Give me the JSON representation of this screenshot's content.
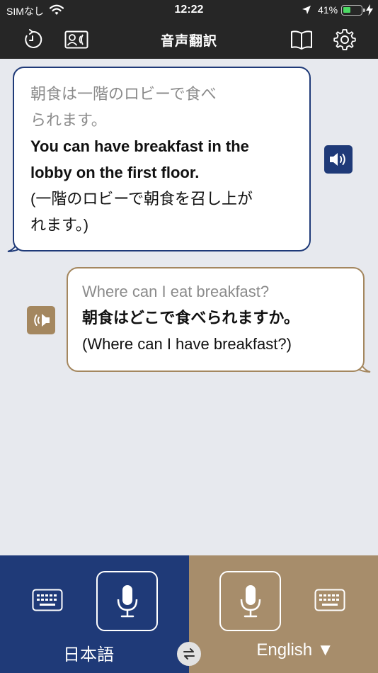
{
  "status_bar": {
    "carrier": "SIMなし",
    "time": "12:22",
    "battery_percent": "41%",
    "battery_level": 0.41,
    "icons": [
      "wifi-icon",
      "location-arrow-icon",
      "battery-icon",
      "charging-bolt-icon"
    ]
  },
  "nav": {
    "title": "音声翻訳",
    "left_icons": [
      "history-icon",
      "contact-card-icon"
    ],
    "right_icons": [
      "book-icon",
      "gear-icon"
    ]
  },
  "conversation": [
    {
      "speaker": "english-side",
      "source_lines": [
        "朝食は一階のロビーで食べ",
        "られます。"
      ],
      "translation_lines": [
        "You can have breakfast in the",
        "lobby on the first floor."
      ],
      "back_translation_lines": [
        "(一階のロビーで朝食を召し上が",
        "れます。)"
      ],
      "action_icon": "speaker-icon"
    },
    {
      "speaker": "japanese-side",
      "source_lines": [
        "Where can I eat breakfast?"
      ],
      "translation_lines": [
        "朝食はどこで食べられますか。"
      ],
      "back_translation_lines": [
        "(Where can I have breakfast?)"
      ],
      "action_icon": "speaker-icon"
    }
  ],
  "bottom": {
    "left_language": "日本語",
    "right_language": "English ▼",
    "mic_icon": "microphone-icon",
    "keyboard_icon": "keyboard-icon",
    "swap_icon": "swap-arrows-icon"
  },
  "colors": {
    "navy": "#1f3a78",
    "tan": "#a78d6b",
    "header": "#262626",
    "background": "#e7e9ee"
  }
}
